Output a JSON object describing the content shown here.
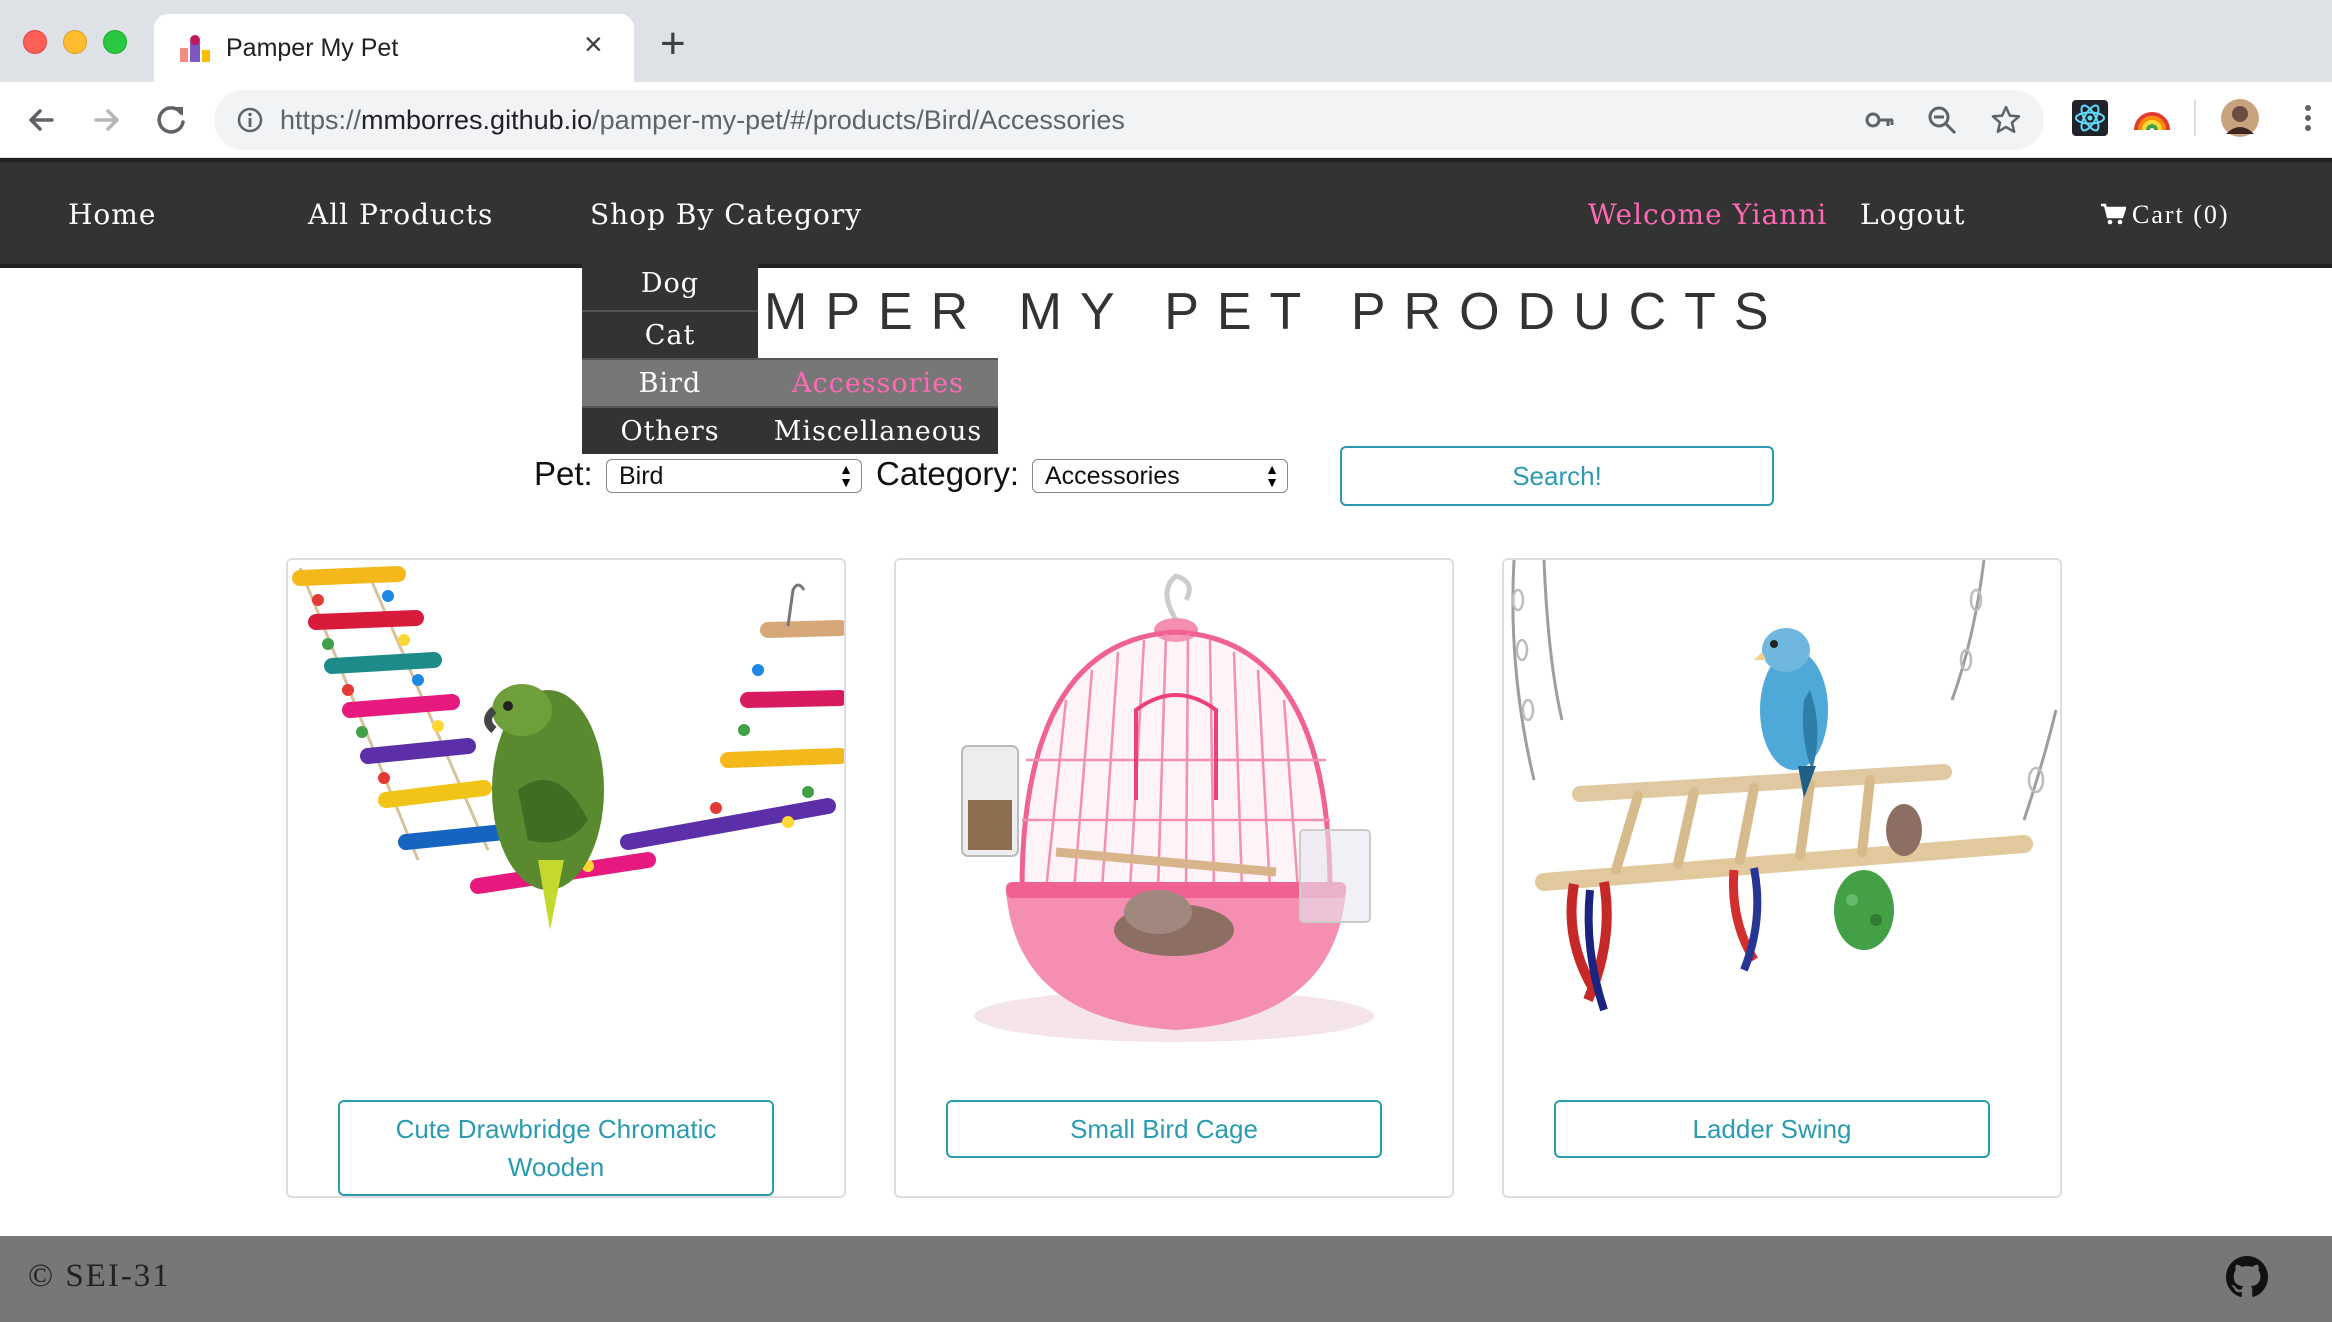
{
  "browser": {
    "tab_title": "Pamper My Pet",
    "url_scheme": "https://",
    "url_host": "mmborres.github.io",
    "url_path": "/pamper-my-pet/#/products/Bird/Accessories"
  },
  "nav": {
    "home": "Home",
    "all_products": "All Products",
    "shop_by_category": "Shop By Category",
    "welcome": "Welcome Yianni",
    "logout": "Logout",
    "cart": "Cart (0)"
  },
  "dropdown": {
    "pets": [
      "Dog",
      "Cat",
      "Bird",
      "Others"
    ],
    "subcategories": [
      "Accessories",
      "Miscellaneous"
    ],
    "active_pet": "Bird",
    "active_subcategory": "Accessories"
  },
  "page": {
    "title": "MPER MY PET PRODUCTS"
  },
  "filters": {
    "pet_label": "Pet:",
    "pet_value": "Bird",
    "category_label": "Category:",
    "category_value": "Accessories",
    "search_label": "Search!"
  },
  "products": [
    {
      "name": "Cute Drawbridge Chromatic Wooden"
    },
    {
      "name": "Small Bird Cage"
    },
    {
      "name": "Ladder Swing"
    }
  ],
  "footer": {
    "copyright": "© SEI-31"
  },
  "colors": {
    "navbar": "#333333",
    "accent_pink": "#ff69b4",
    "button_teal": "#2a9bb0",
    "footer": "#777777"
  }
}
